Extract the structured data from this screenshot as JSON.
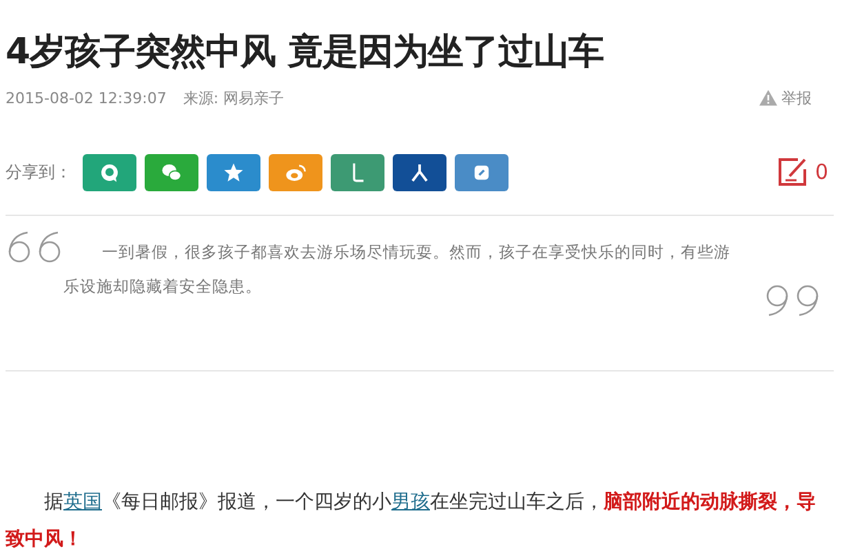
{
  "article": {
    "title": "4岁孩子突然中风 竟是因为坐了过山车",
    "date": "2015-08-02 12:39:07",
    "source": "来源: 网易亲子",
    "report": "举报"
  },
  "share": {
    "label": "分享到：",
    "buttons": [
      {
        "kind": "bubble",
        "color": "#22a67a"
      },
      {
        "kind": "wechat",
        "color": "#2aaa3c"
      },
      {
        "kind": "star",
        "color": "#2b8ccc"
      },
      {
        "kind": "weibo",
        "color": "#ef941c"
      },
      {
        "kind": "hook",
        "color": "#3d9a73"
      },
      {
        "kind": "person",
        "color": "#124f97"
      },
      {
        "kind": "note",
        "color": "#4a8cc6"
      }
    ],
    "comment_count": "0"
  },
  "quote": "一到暑假，很多孩子都喜欢去游乐场尽情玩耍。然而，孩子在享受快乐的同时，有些游乐设施却隐藏着安全隐患。",
  "body": [
    {
      "kind": "text",
      "text": "据"
    },
    {
      "kind": "link",
      "text": "英国"
    },
    {
      "kind": "text",
      "text": "《每日邮报》报道，一个四岁的小"
    },
    {
      "kind": "link",
      "text": "男孩"
    },
    {
      "kind": "text",
      "text": "在坐完过山车之后，"
    },
    {
      "kind": "strong",
      "text": "脑部附近的动脉撕裂，导致中风！"
    }
  ]
}
